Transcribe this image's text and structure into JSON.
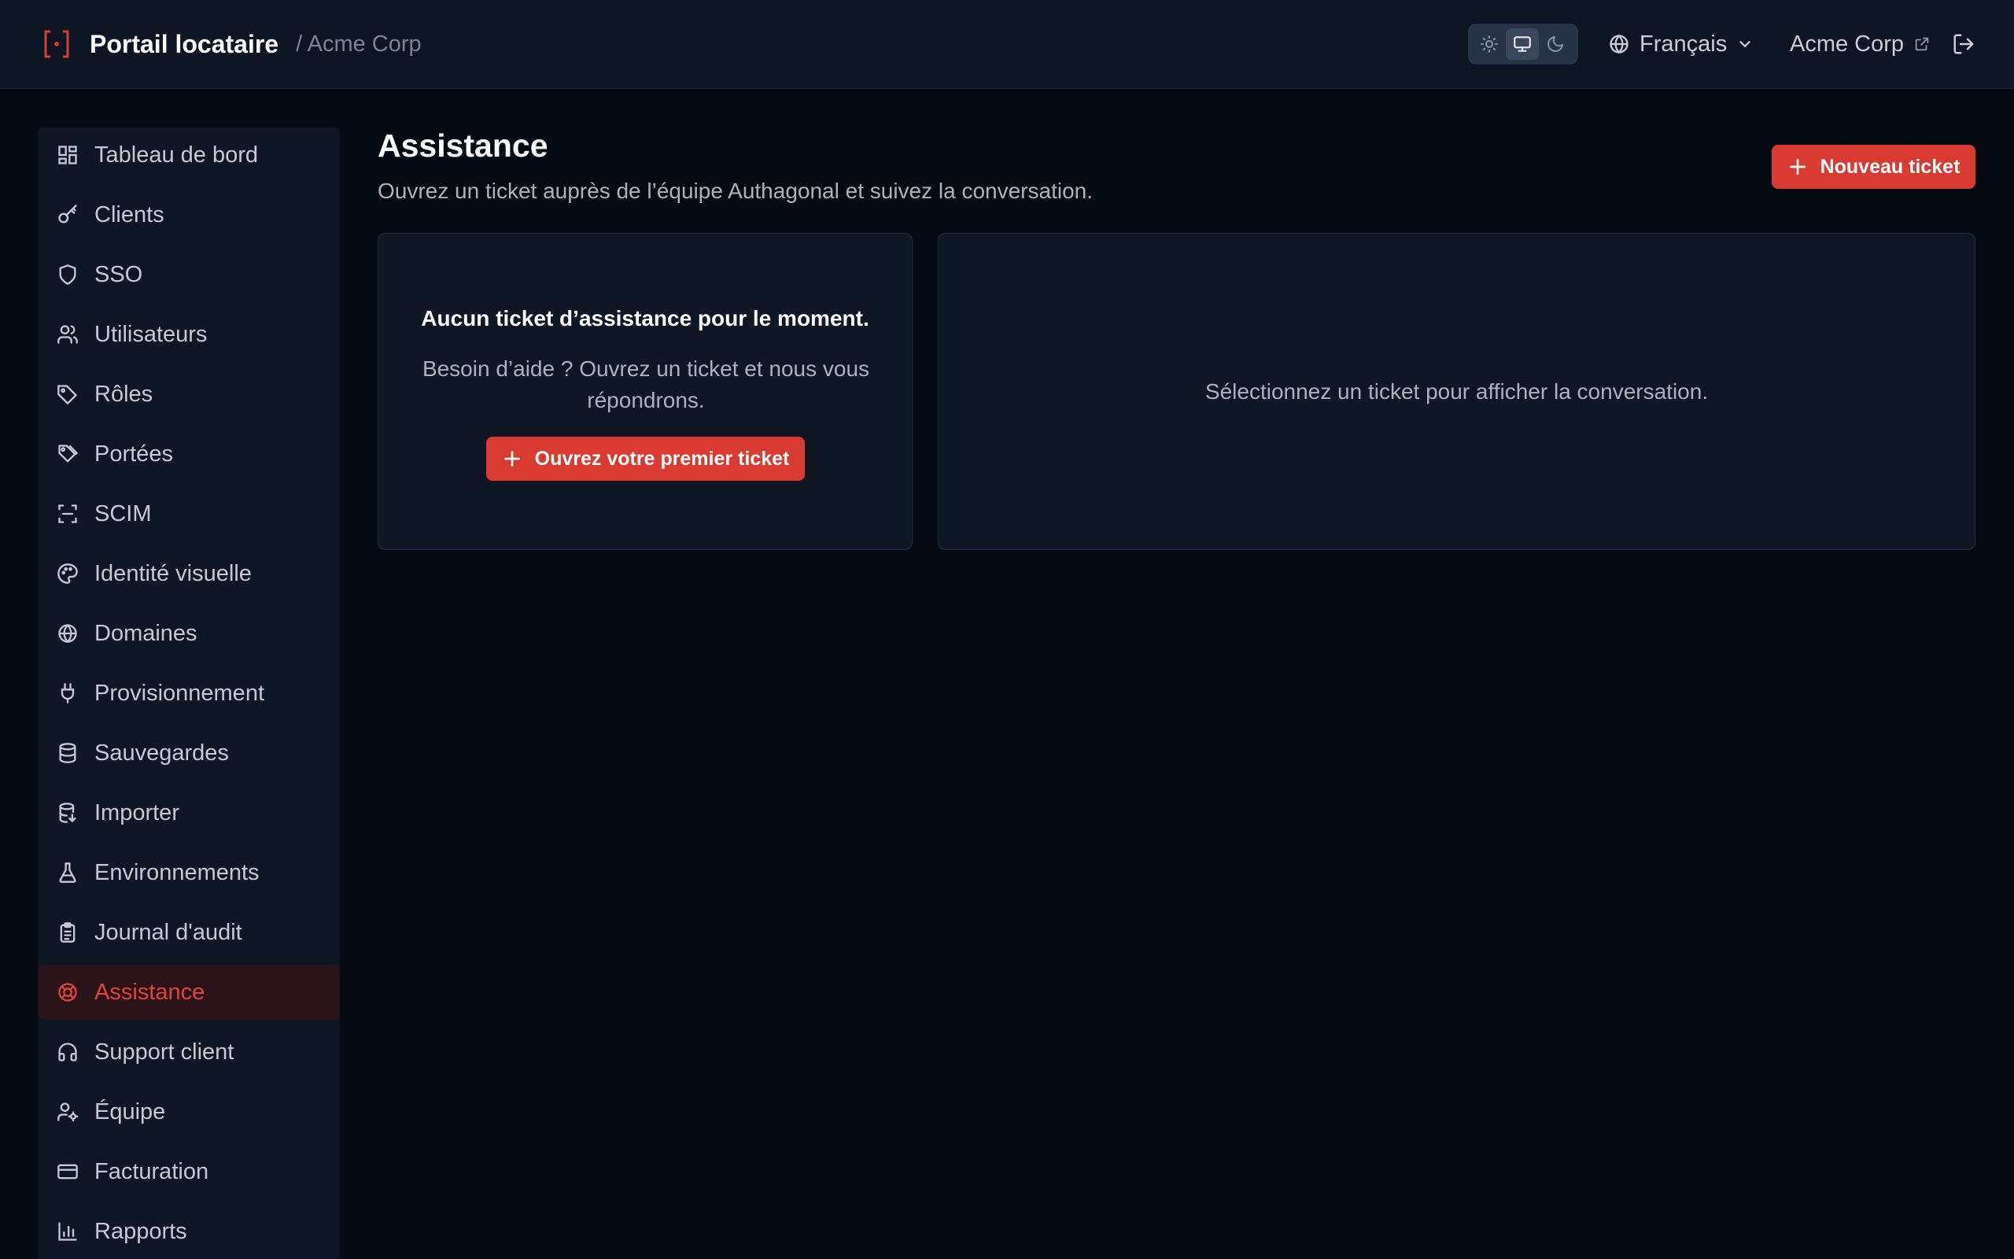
{
  "header": {
    "title": "Portail locataire",
    "breadcrumb": "/ Acme Corp",
    "theme_options": [
      "sun-icon",
      "monitor-icon",
      "moon-icon"
    ],
    "theme_selected": "monitor-icon",
    "language": "Français",
    "tenant": "Acme Corp"
  },
  "sidebar": {
    "items": [
      {
        "label": "Tableau de bord",
        "icon": "dashboard-icon"
      },
      {
        "label": "Clients",
        "icon": "key-icon"
      },
      {
        "label": "SSO",
        "icon": "shield-icon"
      },
      {
        "label": "Utilisateurs",
        "icon": "users-icon"
      },
      {
        "label": "Rôles",
        "icon": "tag-icon"
      },
      {
        "label": "Portées",
        "icon": "tags-icon"
      },
      {
        "label": "SCIM",
        "icon": "scan-icon"
      },
      {
        "label": "Identité visuelle",
        "icon": "palette-icon"
      },
      {
        "label": "Domaines",
        "icon": "globe-icon"
      },
      {
        "label": "Provisionnement",
        "icon": "plug-icon"
      },
      {
        "label": "Sauvegardes",
        "icon": "database-icon"
      },
      {
        "label": "Importer",
        "icon": "database-import-icon"
      },
      {
        "label": "Environnements",
        "icon": "flask-icon"
      },
      {
        "label": "Journal d'audit",
        "icon": "clipboard-icon"
      },
      {
        "label": "Assistance",
        "icon": "life-buoy-icon",
        "active": true
      },
      {
        "label": "Support client",
        "icon": "headphones-icon"
      },
      {
        "label": "Équipe",
        "icon": "user-cog-icon"
      },
      {
        "label": "Facturation",
        "icon": "credit-card-icon"
      },
      {
        "label": "Rapports",
        "icon": "bar-chart-icon"
      }
    ]
  },
  "main": {
    "title": "Assistance",
    "subtitle": "Ouvrez un ticket auprès de l’équipe Authagonal et suivez la conversation.",
    "new_ticket_label": "Nouveau ticket",
    "empty_title": "Aucun ticket d’assistance pour le moment.",
    "empty_text": "Besoin d’aide ? Ouvrez un ticket et nous vous répondrons.",
    "first_ticket_label": "Ouvrez votre premier ticket",
    "select_hint": "Sélectionnez un ticket pour afficher la conversation."
  },
  "colors": {
    "accent": "#d93a31",
    "active_text": "#e0433a",
    "background": "#050a12",
    "panel": "#0f1724"
  }
}
